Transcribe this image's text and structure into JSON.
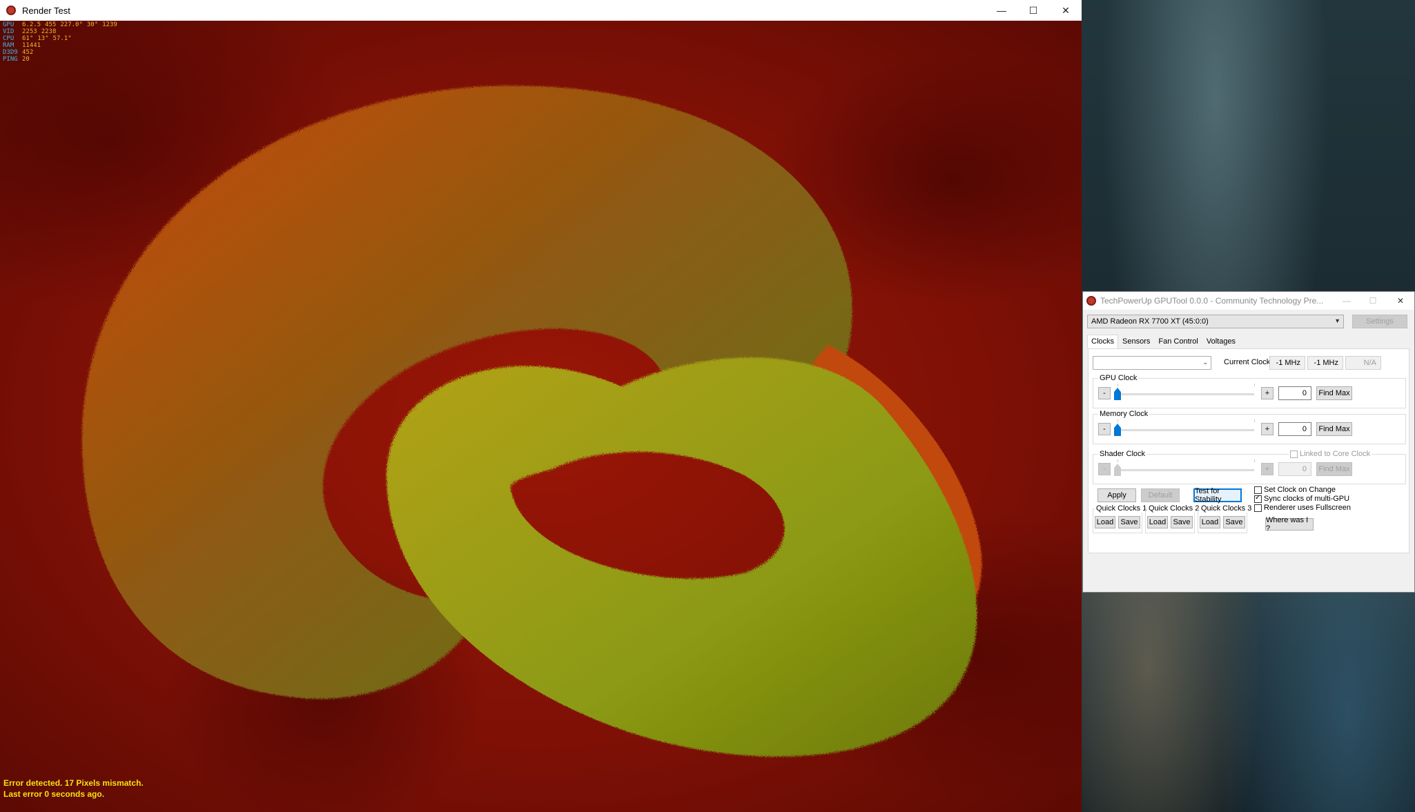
{
  "render_window": {
    "title": "Render Test",
    "osd": [
      {
        "key": "GPU",
        "values": [
          "6.2.5",
          "455",
          "227.0°",
          "30°",
          "1239"
        ]
      },
      {
        "key": "VID",
        "values": [
          "2253",
          "2238"
        ]
      },
      {
        "key": "CPU",
        "values": [
          "61°",
          "13°",
          "57.1°"
        ]
      },
      {
        "key": "RAM",
        "values": [
          "11441"
        ]
      },
      {
        "key": "D3D9",
        "values": [
          "452"
        ]
      },
      {
        "key": "PING",
        "values": [
          "20"
        ]
      }
    ],
    "error_line1": "Error detected. 17 Pixels mismatch.",
    "error_line2": "Last error 0 seconds ago."
  },
  "gputool": {
    "title": "TechPowerUp GPUTool 0.0.0 - Community Technology Pre...",
    "gpu_select": "AMD Radeon RX 7700 XT (45:0:0)",
    "settings_label": "Settings",
    "tabs": [
      "Clocks",
      "Sensors",
      "Fan Control",
      "Voltages"
    ],
    "preset_select": "",
    "current_clocks_label": "Current Clocks:",
    "current_core": "-1 MHz",
    "current_mem": "-1 MHz",
    "current_shader": "N/A",
    "gpu_clock": {
      "label": "GPU Clock",
      "minus": "-",
      "plus": "+",
      "value": "0",
      "find_max": "Find Max",
      "level": 0
    },
    "memory_clock": {
      "label": "Memory Clock",
      "minus": "-",
      "plus": "+",
      "value": "0",
      "find_max": "Find Max",
      "level": 0
    },
    "shader_clock": {
      "label": "Shader Clock",
      "minus": "-",
      "plus": "+",
      "value": "0",
      "find_max": "Find Max",
      "linked_label": "Linked to Core Clock",
      "level": 0
    },
    "apply_label": "Apply",
    "default_label": "Default",
    "stability_label": "Test for Stability",
    "checks": [
      {
        "label": "Set Clock on Change",
        "checked": false
      },
      {
        "label": "Sync clocks of multi-GPU",
        "checked": true
      },
      {
        "label": "Renderer uses Fullscreen",
        "checked": false
      }
    ],
    "quick": [
      {
        "label": "Quick Clocks 1",
        "load": "Load",
        "save": "Save"
      },
      {
        "label": "Quick Clocks 2",
        "load": "Load",
        "save": "Save"
      },
      {
        "label": "Quick Clocks 3",
        "load": "Load",
        "save": "Save"
      }
    ],
    "where_label": "Where was I ?"
  }
}
